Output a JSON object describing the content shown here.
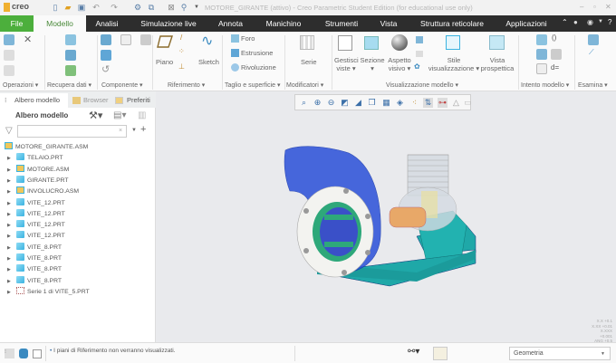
{
  "app": {
    "logo": "creo",
    "window_title": "MOTORE_GIRANTE (attivo) - Creo Parametric Student Edition (for educational use only)"
  },
  "tabs": [
    {
      "label": "File"
    },
    {
      "label": "Modello"
    },
    {
      "label": "Analisi"
    },
    {
      "label": "Simulazione live"
    },
    {
      "label": "Annota"
    },
    {
      "label": "Manichino"
    },
    {
      "label": "Strumenti"
    },
    {
      "label": "Vista"
    },
    {
      "label": "Struttura reticolare"
    },
    {
      "label": "Applicazioni"
    }
  ],
  "ribbon": {
    "groups": [
      "Operazioni ▾",
      "Recupera dati ▾",
      "Componente ▾",
      "Riferimento ▾",
      "Taglio e superficie ▾",
      "Modificatori ▾",
      "Visualizzazione modello ▾",
      "Intento modello ▾",
      "Esamina ▾"
    ],
    "piano": "Piano",
    "sketch": "Sketch",
    "foro": "Foro",
    "estrusione": "Estrusione",
    "rivoluzione": "Rivoluzione",
    "serie": "Serie",
    "gestisci_viste": "Gestisci viste ▾",
    "sezione": "Sezione ▾",
    "aspetto_visivo": "Aspetto visivo ▾",
    "stile": "Stile visualizzazione ▾",
    "vista_prospettica": "Vista prospettica"
  },
  "panel": {
    "tabs": [
      "Albero modello",
      "Browser",
      "Preferiti"
    ],
    "header": "Albero modello",
    "search_placeholder": "",
    "tree": [
      {
        "label": "MOTORE_GIRANTE.ASM",
        "type": "asm",
        "root": true
      },
      {
        "label": "TELAIO.PRT",
        "type": "prt"
      },
      {
        "label": "MOTORE.ASM",
        "type": "asm"
      },
      {
        "label": "GIRANTE.PRT",
        "type": "prt"
      },
      {
        "label": "INVOLUCRO.ASM",
        "type": "asm"
      },
      {
        "label": "VITE_12.PRT",
        "type": "prt"
      },
      {
        "label": "VITE_12.PRT",
        "type": "prt"
      },
      {
        "label": "VITE_12.PRT",
        "type": "prt"
      },
      {
        "label": "VITE_12.PRT",
        "type": "prt"
      },
      {
        "label": "VITE_8.PRT",
        "type": "prt"
      },
      {
        "label": "VITE_8.PRT",
        "type": "prt"
      },
      {
        "label": "VITE_8.PRT",
        "type": "prt"
      },
      {
        "label": "VITE_8.PRT",
        "type": "prt"
      },
      {
        "label": "Serie 1 di VITE_5.PRT",
        "type": "pattern"
      }
    ]
  },
  "viewport": {
    "tolerances": [
      "X.X +0.1",
      "X.XX +0.01",
      "X.XXX +0.001",
      "ANG +0.5"
    ]
  },
  "status": {
    "message": "I piani di Riferimento non verranno visualizzati.",
    "filter": "Geometria"
  },
  "colors": {
    "file_tab": "#4caf3c",
    "tabbar": "#2d2d2d",
    "accent": "#3bb3e0"
  }
}
